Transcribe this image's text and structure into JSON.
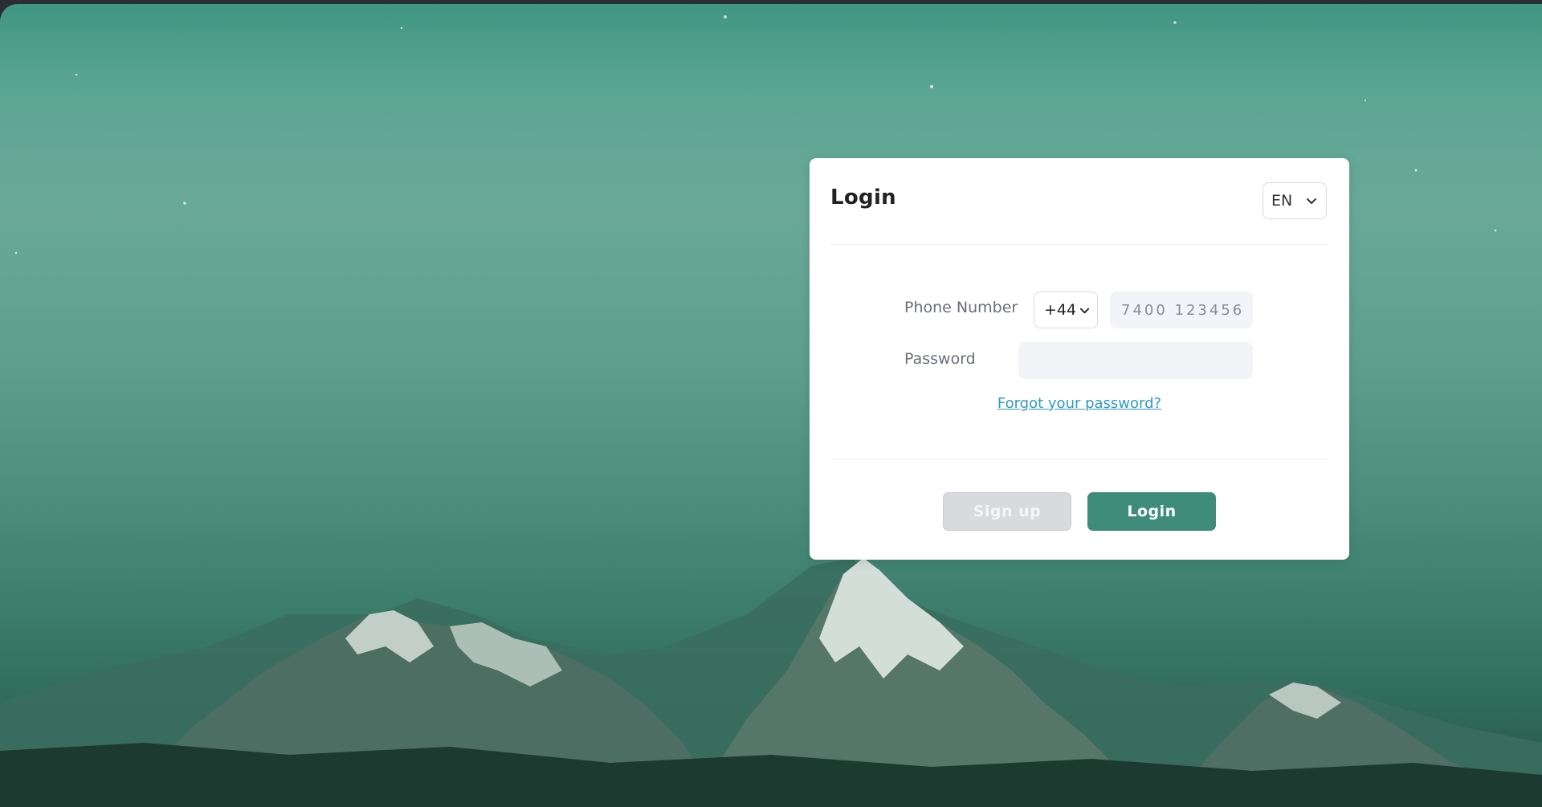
{
  "login": {
    "title": "Login",
    "language": "EN",
    "phone_label": "Phone Number",
    "country_code": "+44",
    "phone_placeholder": "7400 123456",
    "phone_value": "",
    "password_label": "Password",
    "password_value": "",
    "forgot_link": "Forgot your password?",
    "signup_label": "Sign up",
    "login_label": "Login"
  },
  "colors": {
    "accent": "#3f8c7a",
    "link": "#2f9ac4",
    "disabled_button": "#d8dadd",
    "input_bg": "#f3f4f7"
  },
  "icons": [
    "chevron-down-icon"
  ]
}
